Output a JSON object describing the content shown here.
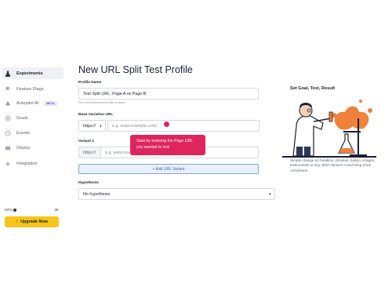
{
  "sidebar": {
    "items": [
      {
        "label": "Experiments",
        "icon": "flask-icon",
        "active": true
      },
      {
        "label": "Feature Flags",
        "icon": "flag-icon",
        "active": false
      },
      {
        "label": "Autopilot AI",
        "icon": "robot-icon",
        "active": false,
        "badge": "BETA"
      },
      {
        "label": "Goals",
        "icon": "target-icon",
        "active": false
      },
      {
        "label": "Events",
        "icon": "events-icon",
        "active": false
      },
      {
        "label": "Deploy",
        "icon": "deploy-icon",
        "active": false
      },
      {
        "label": "Integration",
        "icon": "integration-icon",
        "active": false
      }
    ],
    "mtu_label": "MTU",
    "mtu_value": "2K",
    "upgrade_label": "Upgrade Now"
  },
  "main": {
    "title": "New URL Split Test Profile",
    "profile_name": {
      "label": "Profile Name",
      "value": "Test Split URL: Page A vs Page B",
      "help": "Give the experiment profile a name"
    },
    "base_variation": {
      "label": "Base Variation URL",
      "protocol": "https://",
      "placeholder": "e.g. www.example.com/"
    },
    "variant": {
      "label": "Variant 1",
      "protocol": "https://",
      "placeholder": "e.g. www.exa"
    },
    "add_url_label": "+ Add URL Variant",
    "hypothesis": {
      "label": "Hypothesis",
      "value": "No hypothesis"
    },
    "tooltip": "Start by entering the Page URL you wanted to test"
  },
  "panel": {
    "title": "Set Goal, Test, Result",
    "description": "Simple change on headline, phrases, button, images, testimonials or any other element could bring more conversion."
  },
  "colors": {
    "accent": "#3a63c7",
    "tooltip": "#e0245e",
    "upgrade": "#f5c518"
  }
}
